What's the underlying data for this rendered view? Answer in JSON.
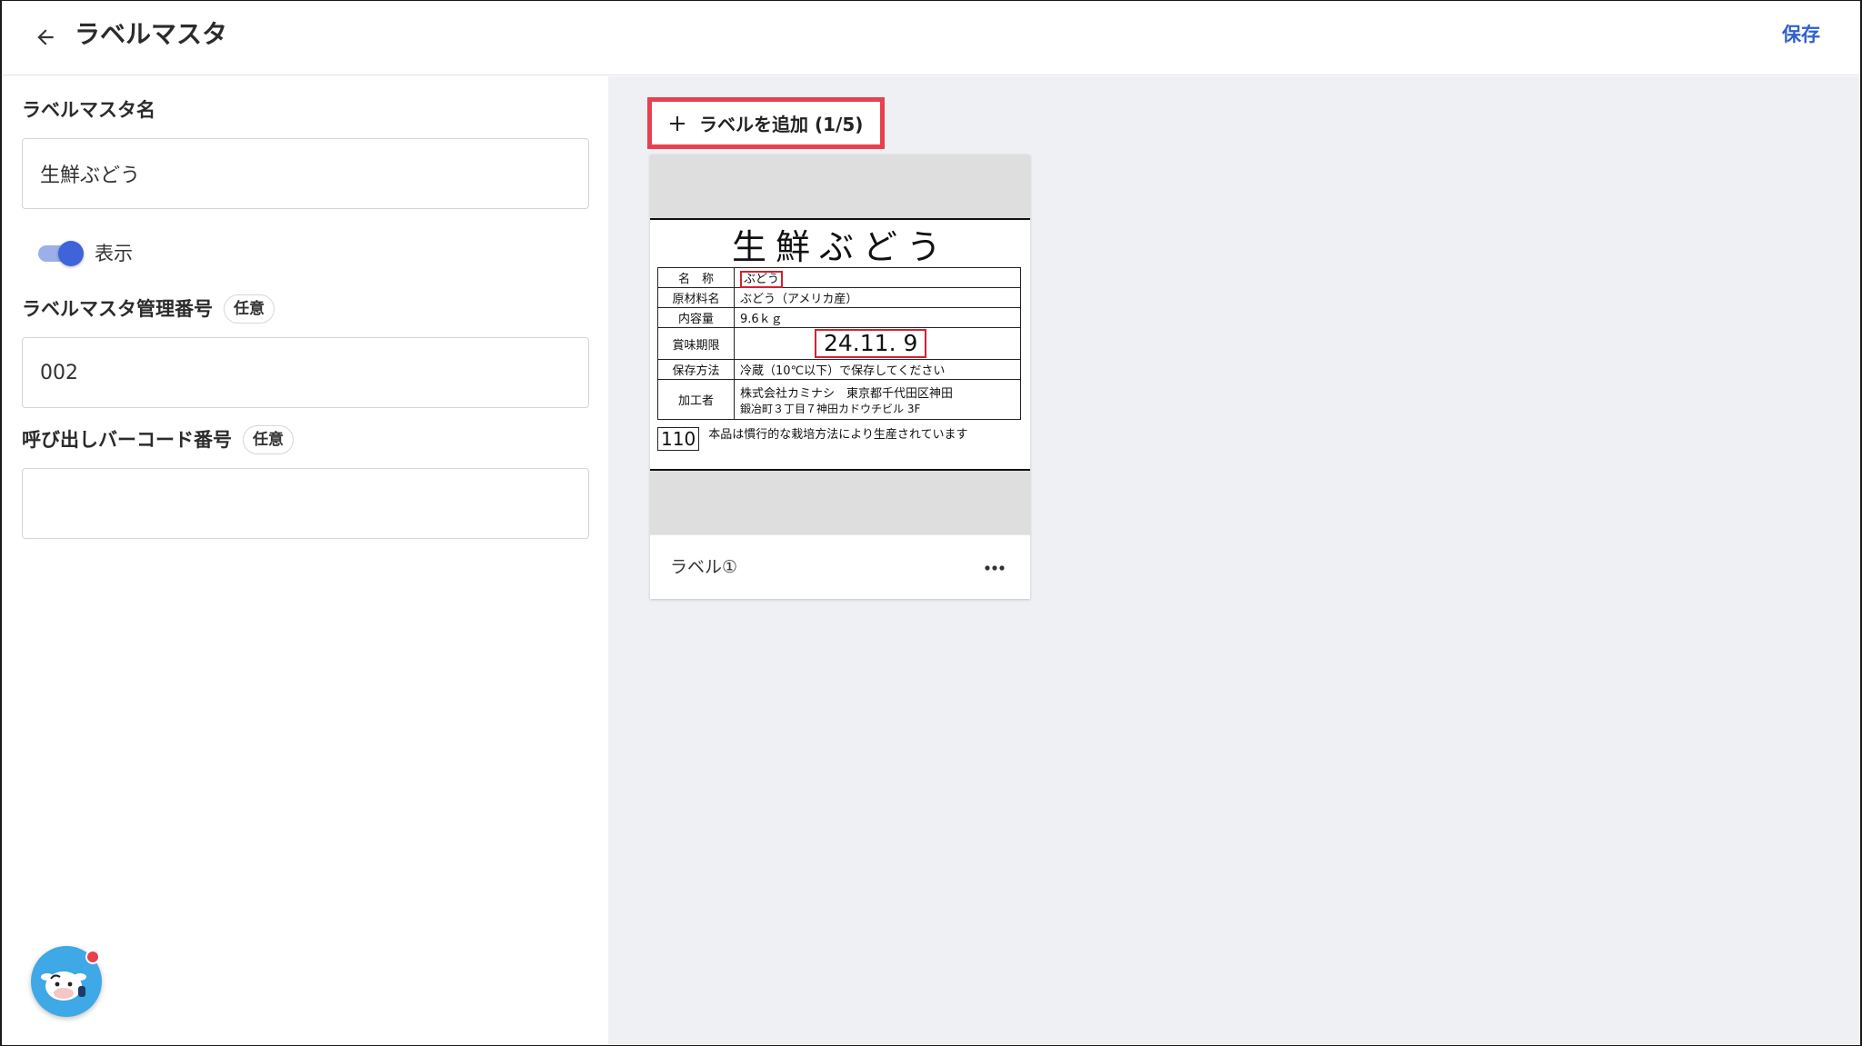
{
  "header": {
    "title": "ラベルマスタ",
    "save_label": "保存"
  },
  "form": {
    "name_label": "ラベルマスタ名",
    "name_value": "生鮮ぶどう",
    "display_toggle_label": "表示",
    "display_toggle_on": true,
    "management_number_label": "ラベルマスタ管理番号",
    "management_number_optional": "任意",
    "management_number_value": "002",
    "barcode_label": "呼び出しバーコード番号",
    "barcode_optional": "任意",
    "barcode_value": ""
  },
  "labels_panel": {
    "add_button_label": "ラベルを追加 (1/5)",
    "cards": [
      {
        "name": "ラベル①",
        "preview": {
          "product": "生鮮ぶどう",
          "rows": [
            {
              "key": "名　称",
              "value": "ぶどう"
            },
            {
              "key": "原材料名",
              "value": "ぶどう（アメリカ産）"
            },
            {
              "key": "内容量",
              "value": "9.6ｋｇ"
            },
            {
              "key": "賞味期限",
              "value": "24.11. 9"
            },
            {
              "key": "保存方法",
              "value": "冷蔵（10℃以下）で保存してください"
            },
            {
              "key": "加工者",
              "value": "株式会社カミナシ　東京都千代田区神田",
              "value2": "鍛冶町３丁目７神田カドウチビル 3F"
            }
          ],
          "code": "110",
          "note": "本品は慣行的な栽培方法により生産されています"
        }
      }
    ]
  },
  "colors": {
    "accent": "#2f5fd0",
    "highlight": "#e8404f",
    "panel_bg": "#eff0f4",
    "toggle_on": "#3f63d8"
  }
}
